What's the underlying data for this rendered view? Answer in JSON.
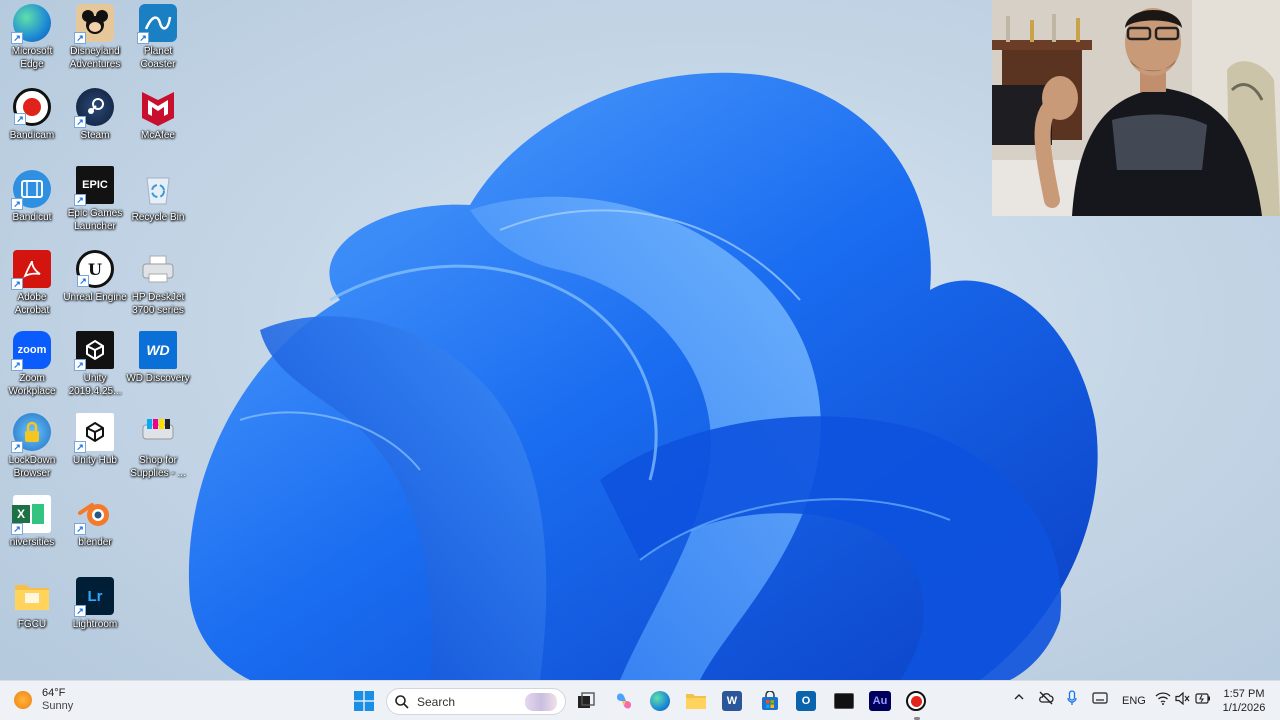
{
  "desktop": {
    "icons": [
      {
        "label": "Microsoft Edge"
      },
      {
        "label": "Disneyland Adventures"
      },
      {
        "label": "Planet Coaster"
      },
      {
        "label": "Bandicam"
      },
      {
        "label": "Steam"
      },
      {
        "label": "McAfee"
      },
      {
        "label": "Bandicut"
      },
      {
        "label": "Epic Games Launcher",
        "glyph": "EPIC"
      },
      {
        "label": "Recycle Bin"
      },
      {
        "label": "Adobe Acrobat"
      },
      {
        "label": "Unreal Engine"
      },
      {
        "label": "HP DeskJet 3700 series"
      },
      {
        "label": "Zoom Workplace",
        "glyph": "zoom"
      },
      {
        "label": "Unity 2019.4.25..."
      },
      {
        "label": "WD Discovery",
        "glyph": "WD"
      },
      {
        "label": "LockDown Browser"
      },
      {
        "label": "Unity Hub"
      },
      {
        "label": "Shop for Supplies - ..."
      },
      {
        "label": "niversities",
        "glyph": "X"
      },
      {
        "label": "blender"
      },
      {
        "label": "FGCU"
      },
      {
        "label": "Lightroom",
        "glyph": "Lr"
      }
    ]
  },
  "taskbar": {
    "weather": {
      "temp": "64°F",
      "condition": "Sunny"
    },
    "search": {
      "label": "Search"
    },
    "apps": {
      "audition_glyph": "Au"
    },
    "tray": {
      "language": "ENG",
      "time": "1:57 PM",
      "date": "1/1/2026"
    }
  },
  "colors": {
    "accent": "#1a73e8",
    "bloom": "#1565e6",
    "taskbar_bg": "#eef1f6"
  }
}
